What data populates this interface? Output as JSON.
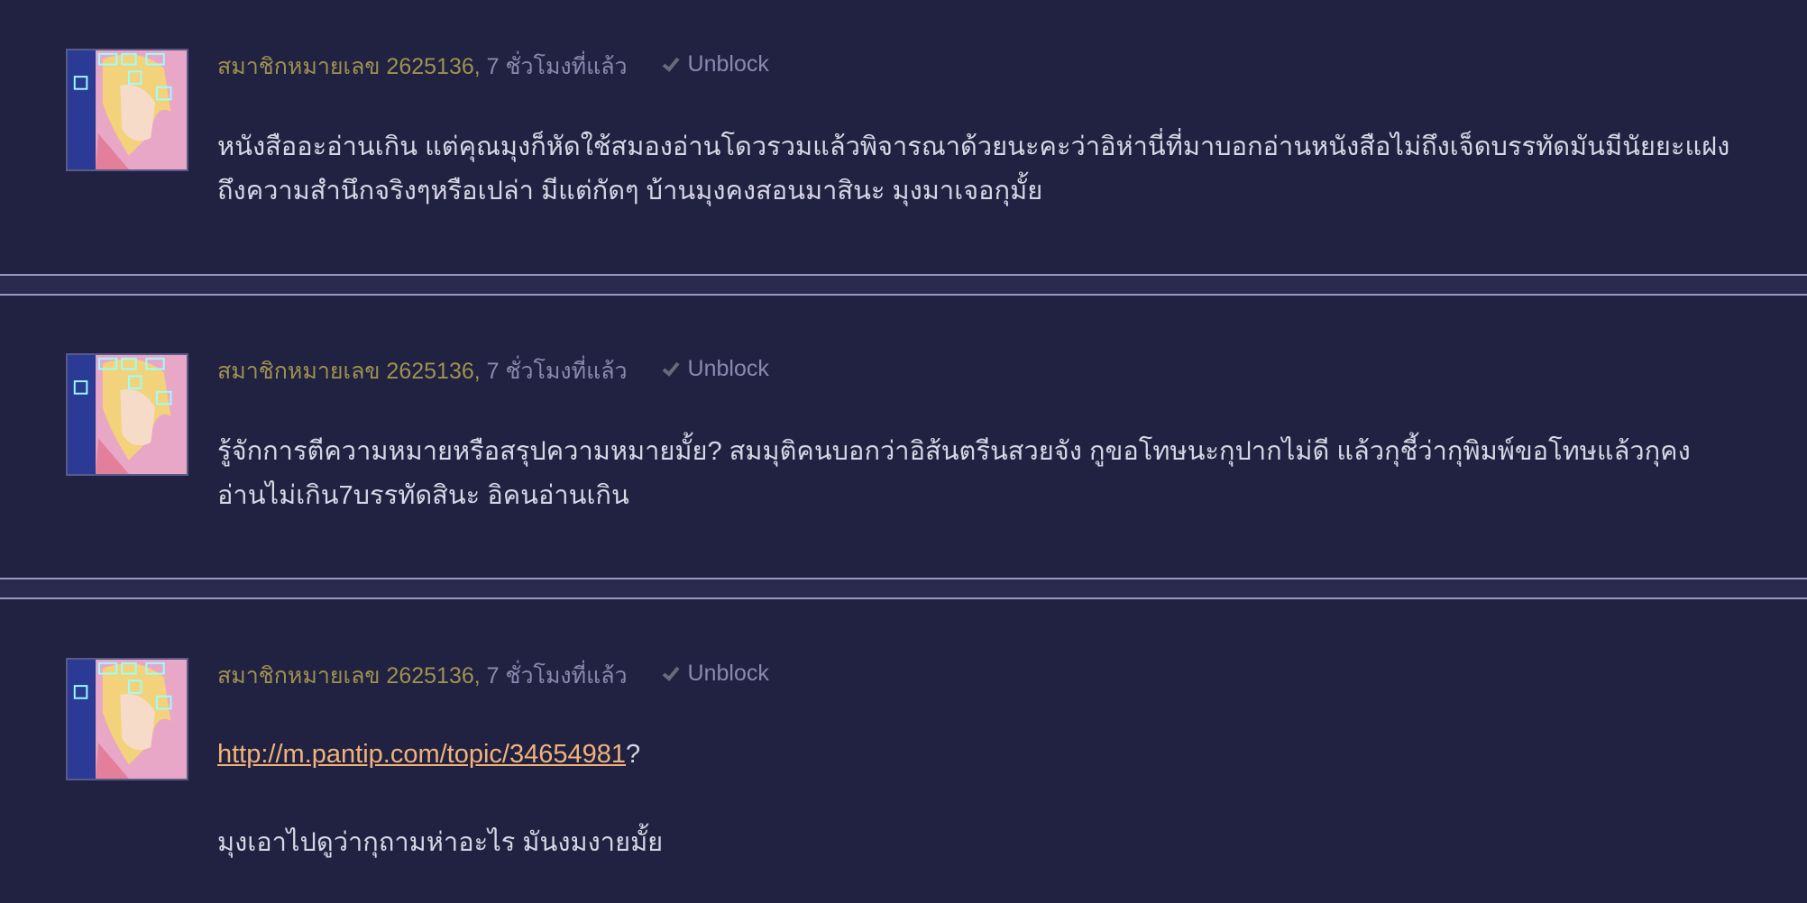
{
  "comments": [
    {
      "member": "สมาชิกหมายเลข 2625136",
      "separator": ",",
      "time": "7 ชั่วโมงที่แล้ว",
      "unblock_label": "Unblock",
      "text_line1": "หนังสืออะอ่านเกิน แต่คุณมุงก็หัดใช้สมองอ่านโดวรวมแล้วพิจารณาด้วยนะคะว่าอิห่านี่ที่มาบอกอ่านหนังสือไม่ถึงเจ็ดบรรทัดมันมีนัยยะแฝง",
      "text_line2": "ถึงความสำนึกจริงๆหรือเปล่า มีแต่กัดๆ บ้านมุงคงสอนมาสินะ มุงมาเจอกุมั้ย"
    },
    {
      "member": "สมาชิกหมายเลข 2625136",
      "separator": ",",
      "time": "7 ชั่วโมงที่แล้ว",
      "unblock_label": "Unblock",
      "text_line1": "รู้จักการตีความหมายหรือสรุปความหมายมั้ย?  สมมุติคนบอกว่าอิส้นตรีนสวยจัง กูขอโทษนะกุปากไม่ดี แล้วกุชี้ว่ากุพิมพ์ขอโทษแล้วกุคง",
      "text_line2": "อ่านไม่เกิน7บรรทัดสินะ อิคนอ่านเกิน"
    },
    {
      "member": "สมาชิกหมายเลข 2625136",
      "separator": ",",
      "time": "7 ชั่วโมงที่แล้ว",
      "unblock_label": "Unblock",
      "link_text": "http://m.pantip.com/topic/34654981",
      "link_suffix": "?",
      "text_line2": "มุงเอาไปดูว่ากุถามห่าอะไร มันงมงายมั้ย"
    }
  ],
  "icons": {
    "unblock": "check-icon",
    "avatar": "anime-avatar-image"
  },
  "colors": {
    "background": "#212141",
    "member": "#9e9250",
    "meta": "#8a8ab0",
    "body": "#d6d6e6",
    "link": "#f0b37a",
    "divider_line": "#9a9ac0"
  }
}
